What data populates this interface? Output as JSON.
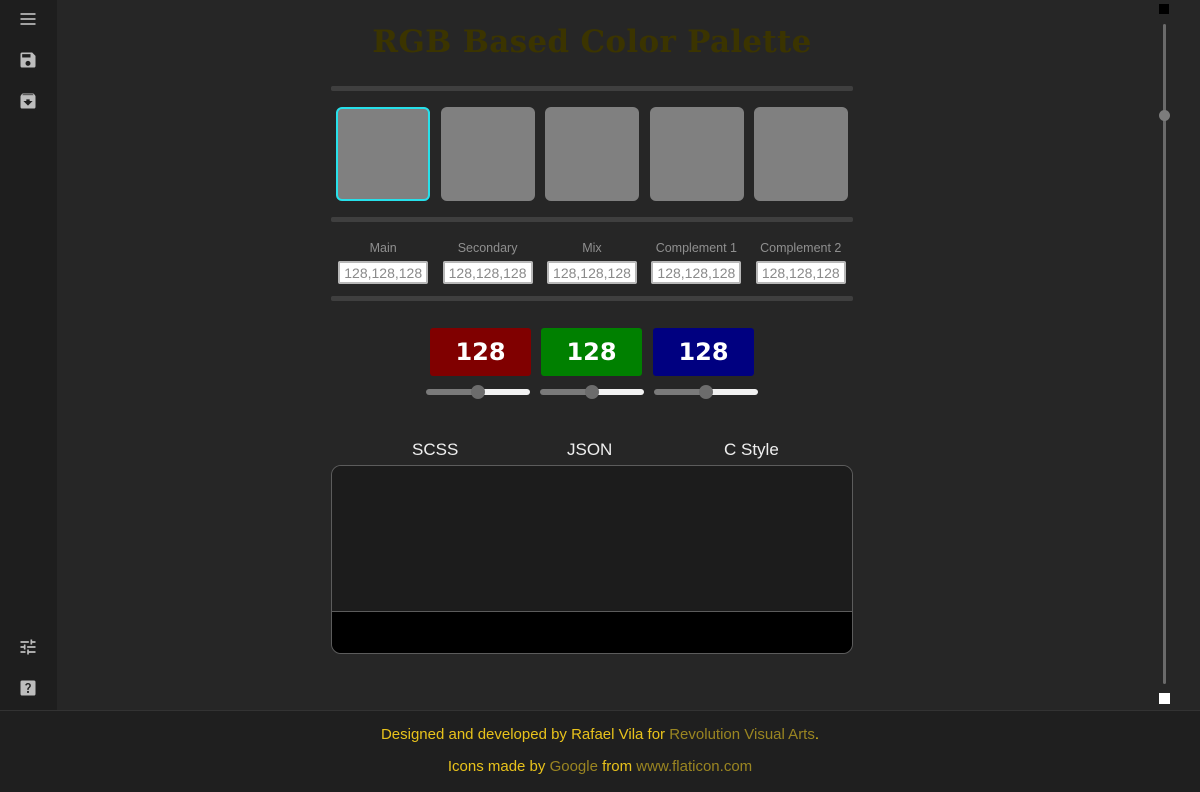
{
  "app": {
    "title": "RGB Based Color Palette"
  },
  "sidebar": {
    "top_icons": [
      "menu-icon",
      "save-icon",
      "archive-download-icon"
    ],
    "bottom_icons": [
      "tune-icon",
      "help-icon"
    ]
  },
  "swatches": [
    {
      "color": "#808080",
      "selected": true
    },
    {
      "color": "#808080",
      "selected": false
    },
    {
      "color": "#808080",
      "selected": false
    },
    {
      "color": "#808080",
      "selected": false
    },
    {
      "color": "#808080",
      "selected": false
    }
  ],
  "fields": [
    {
      "label": "Main",
      "value": "128,128,128"
    },
    {
      "label": "Secondary",
      "value": "128,128,128"
    },
    {
      "label": "Mix",
      "value": "128,128,128"
    },
    {
      "label": "Complement 1",
      "value": "128,128,128"
    },
    {
      "label": "Complement 2",
      "value": "128,128,128"
    }
  ],
  "rgb": {
    "red": {
      "value": "128",
      "color": "#800000",
      "slider_fraction": 0.5
    },
    "green": {
      "value": "128",
      "color": "#008000",
      "slider_fraction": 0.5
    },
    "blue": {
      "value": "128",
      "color": "#000080",
      "slider_fraction": 0.5
    }
  },
  "output": {
    "tabs": [
      "SCSS",
      "JSON",
      "C Style"
    ],
    "code": ""
  },
  "footer": {
    "line1_prefix": "Designed and developed by Rafael Vila for ",
    "line1_link": "Revolution Visual Arts",
    "line1_suffix": ".",
    "line2_prefix": "Icons made by ",
    "line2_link1": "Google",
    "line2_middle": " from ",
    "line2_link2": "www.flaticon.com"
  },
  "colors": {
    "accent_selected": "#27e0ea",
    "footer_text": "#e8c21b",
    "title": "#3b3400"
  }
}
